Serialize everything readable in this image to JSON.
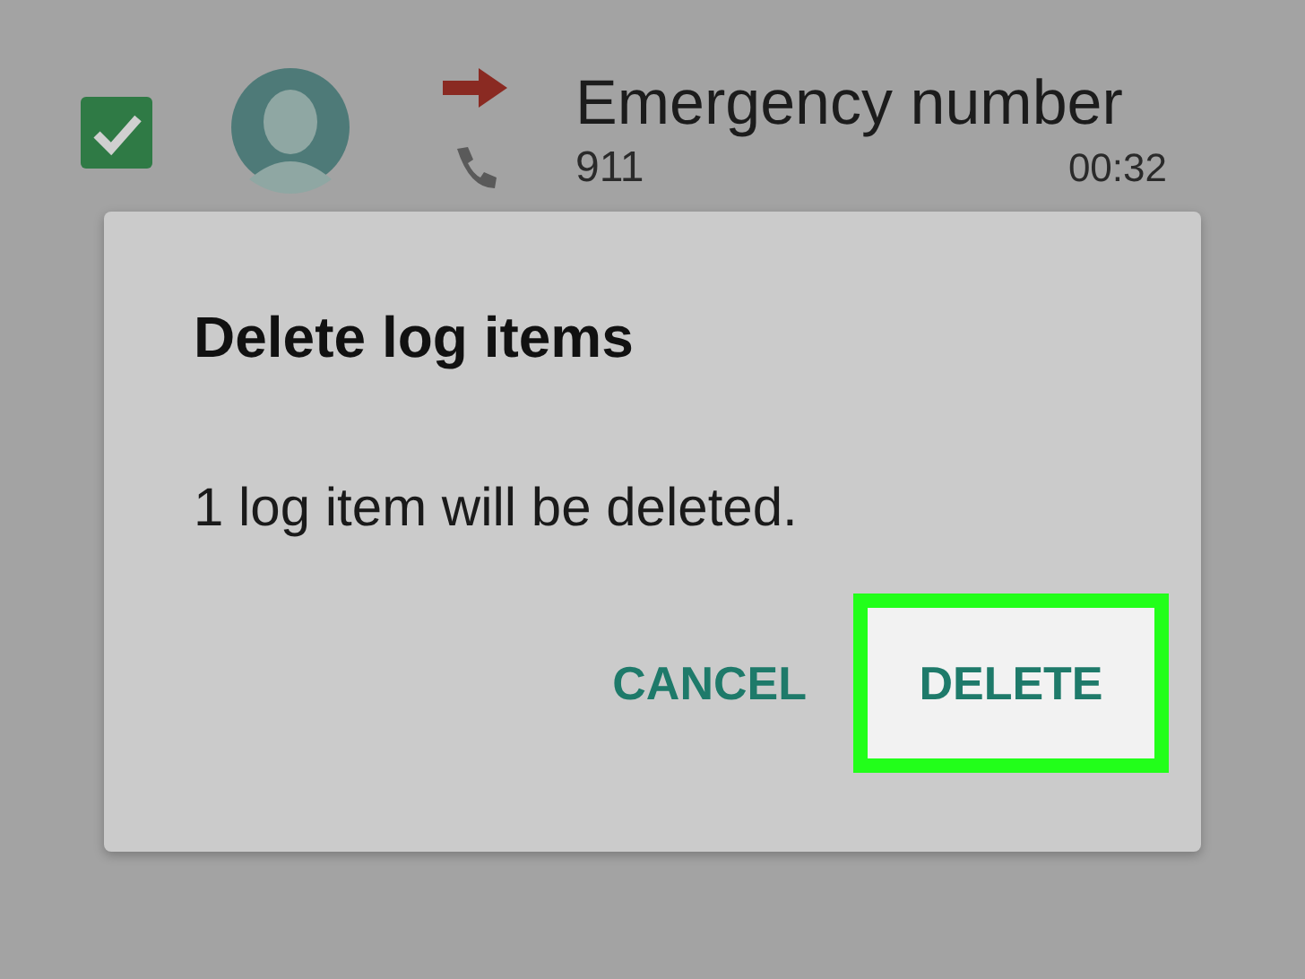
{
  "log_entry": {
    "checked": true,
    "name": "Emergency number",
    "number": "911",
    "duration": "00:32"
  },
  "dialog": {
    "title": "Delete log items",
    "message": "1 log item will be deleted.",
    "buttons": [
      {
        "label": "CANCEL",
        "highlighted": false
      },
      {
        "label": "DELETE",
        "highlighted": true
      }
    ]
  }
}
